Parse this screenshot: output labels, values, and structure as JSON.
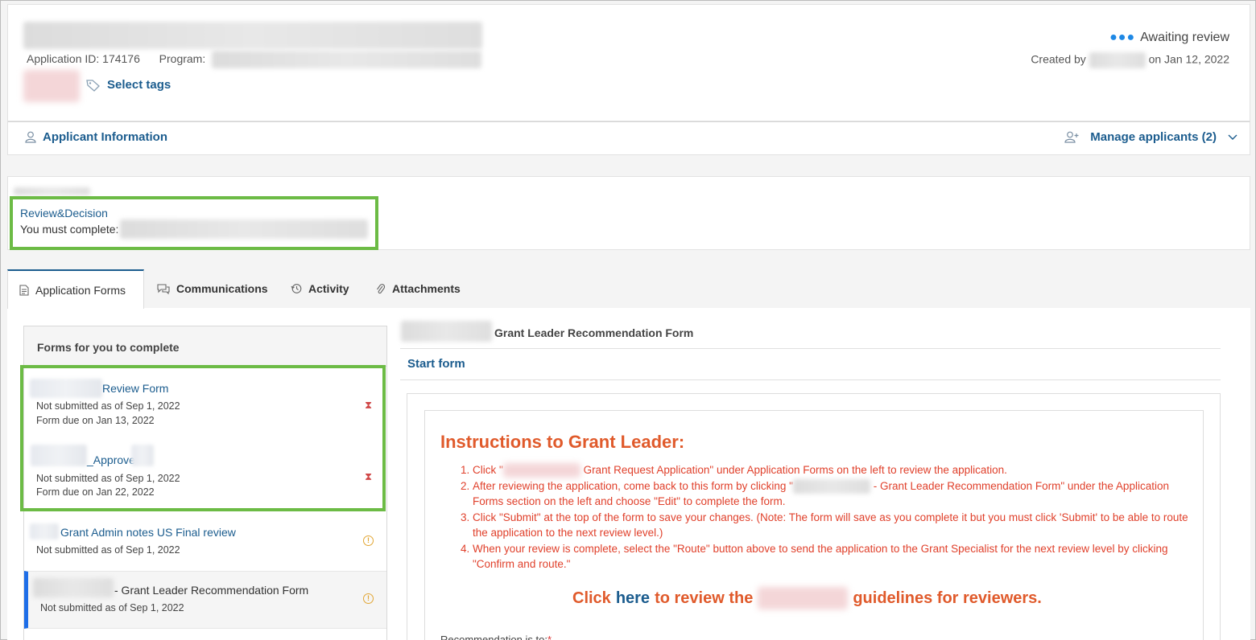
{
  "header": {
    "application_id_label": "Application ID: 174176",
    "program_label": "Program:",
    "status": "Awaiting review",
    "created_by_label": "Created by",
    "created_on": "on Jan 12, 2022",
    "select_tags": "Select tags"
  },
  "applicant_bar": {
    "applicant_info": "Applicant Information",
    "manage_applicants": "Manage applicants (2)"
  },
  "review": {
    "step": "Review&Decision",
    "must_complete": "You must complete:"
  },
  "tabs": [
    {
      "label": "Application Forms"
    },
    {
      "label": "Communications"
    },
    {
      "label": "Activity"
    },
    {
      "label": "Attachments"
    }
  ],
  "forms": {
    "heading": "Forms for you to complete",
    "items": [
      {
        "title": "Review Form",
        "status": "Not submitted as of Sep 1, 2022",
        "due": "Form due on Jan 13, 2022"
      },
      {
        "title": "_Approve",
        "status": "Not submitted as of Sep 1, 2022",
        "due": "Form due on Jan 22, 2022"
      },
      {
        "title": "Grant Admin notes US Final review",
        "status": "Not submitted as of Sep 1, 2022"
      },
      {
        "title": "- Grant Leader Recommendation Form",
        "status": "Not submitted as of Sep 1, 2022"
      }
    ]
  },
  "right": {
    "form_title": "Grant Leader Recommendation Form",
    "start_form": "Start form",
    "instructions_title": "Instructions to Grant Leader:",
    "steps": [
      {
        "a": "Click \"",
        "b": "Grant Request Application\" under Application Forms on the left to review the application."
      },
      {
        "a": "After reviewing the application, come back to this form by clicking \"",
        "b": "- Grant Leader Recommendation Form\" under the Application Forms section on the left and choose \"Edit\" to complete the form."
      },
      {
        "a": "Click \"Submit\" at the top of the form to save your changes. (Note: The form will save as you complete it but you must click 'Submit' to be able to route the application to the next review level.)",
        "b": ""
      },
      {
        "a": "When your review is complete, select the \"Route\" button above to send the application to the Grant Specialist for the next review level by clicking \"Confirm and route.\"",
        "b": ""
      }
    ],
    "click_pre": "Click",
    "click_here": "here",
    "click_mid": "to review the",
    "click_post": "guidelines for reviewers.",
    "recommendation_label": "Recommendation is to:"
  },
  "colors": {
    "link": "#1b5c8e",
    "highlight_border": "#6cbb45",
    "instruction_text": "#e0402b",
    "status_dots": "#1e88e5"
  }
}
